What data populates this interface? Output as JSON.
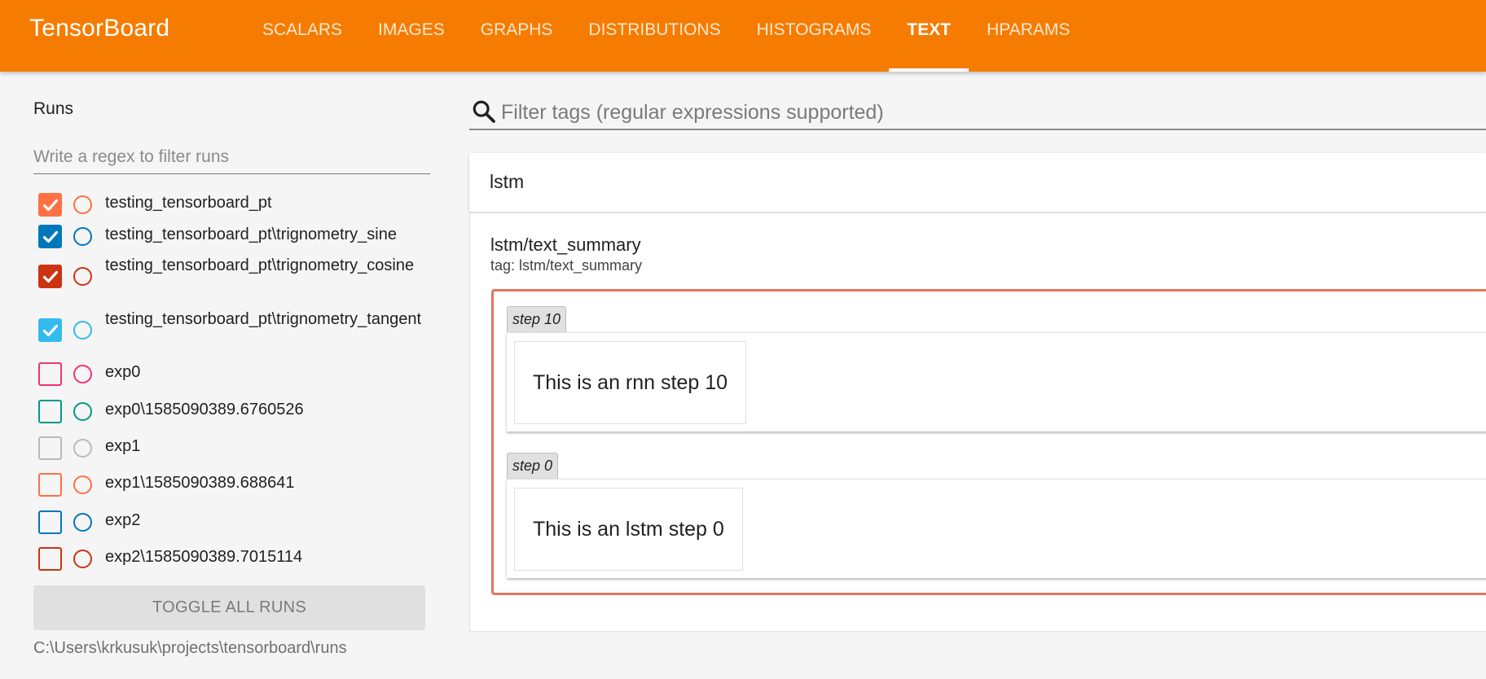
{
  "app": {
    "title": "TensorBoard",
    "accent_color": "#f57c00"
  },
  "tabs": [
    {
      "label": "SCALARS",
      "active": false
    },
    {
      "label": "IMAGES",
      "active": false
    },
    {
      "label": "GRAPHS",
      "active": false
    },
    {
      "label": "DISTRIBUTIONS",
      "active": false
    },
    {
      "label": "HISTOGRAMS",
      "active": false
    },
    {
      "label": "TEXT",
      "active": true
    },
    {
      "label": "HPARAMS",
      "active": false
    }
  ],
  "sidebar": {
    "runs_title": "Runs",
    "filter_placeholder": "Write a regex to filter runs",
    "runs": [
      {
        "label": "testing_tensorboard_pt",
        "checked": true,
        "color": "#ff7043"
      },
      {
        "label": "testing_tensorboard_pt\\trignometry_sine",
        "checked": true,
        "color": "#0077bb"
      },
      {
        "label": "testing_tensorboard_pt\\trignometry_cosine",
        "checked": true,
        "color": "#cc3311"
      },
      {
        "label": "testing_tensorboard_pt\\trignometry_tangent",
        "checked": true,
        "color": "#33bbee"
      },
      {
        "label": "exp0",
        "checked": false,
        "color": "#ee3377"
      },
      {
        "label": "exp0\\1585090389.6760526",
        "checked": false,
        "color": "#009988"
      },
      {
        "label": "exp1",
        "checked": false,
        "color": "#bbbbbb"
      },
      {
        "label": "exp1\\1585090389.688641",
        "checked": false,
        "color": "#ff7043"
      },
      {
        "label": "exp2",
        "checked": false,
        "color": "#0077bb"
      },
      {
        "label": "exp2\\1585090389.7015114",
        "checked": false,
        "color": "#cc3311"
      }
    ],
    "toggle_all_label": "TOGGLE ALL RUNS",
    "logdir": "C:\\Users\\krkusuk\\projects\\tensorboard\\runs"
  },
  "main": {
    "tag_filter_placeholder": "Filter tags (regular expressions supported)",
    "category": {
      "title": "lstm",
      "card": {
        "title": "lstm/text_summary",
        "tag_line": "tag: lstm/text_summary",
        "border_color": "#e8745a",
        "steps": [
          {
            "badge": "step 10",
            "text": "This is an rnn step 10"
          },
          {
            "badge": "step 0",
            "text": "This is an lstm step 0"
          }
        ]
      }
    }
  }
}
